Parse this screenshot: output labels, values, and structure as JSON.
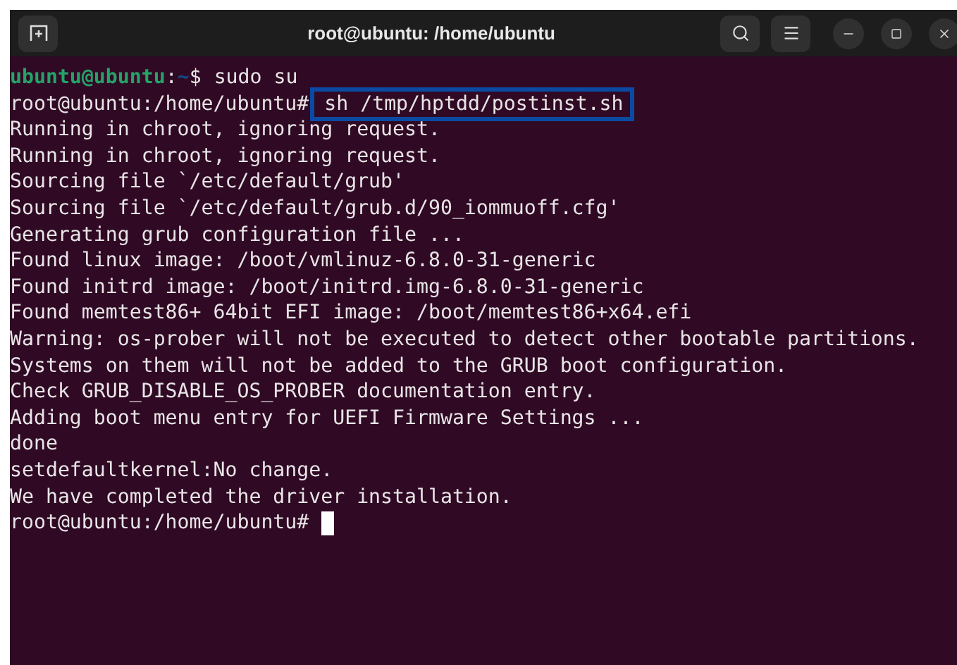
{
  "window": {
    "title": "root@ubuntu: /home/ubuntu"
  },
  "terminal": {
    "lines": [
      {
        "kind": "user_prompt",
        "user_host": "ubuntu@ubuntu",
        "separator": ":",
        "path": "~",
        "symbol": "$",
        "command": "sudo su"
      },
      {
        "kind": "root_prompt",
        "prompt": "root@ubuntu:/home/ubuntu#",
        "command": "sh /tmp/hptdd/postinst.sh",
        "highlighted": true,
        "cursor": false
      },
      {
        "kind": "output",
        "text": "Running in chroot, ignoring request."
      },
      {
        "kind": "output",
        "text": "Running in chroot, ignoring request."
      },
      {
        "kind": "output",
        "text": "Sourcing file `/etc/default/grub'"
      },
      {
        "kind": "output",
        "text": "Sourcing file `/etc/default/grub.d/90_iommuoff.cfg'"
      },
      {
        "kind": "output",
        "text": "Generating grub configuration file ..."
      },
      {
        "kind": "output",
        "text": "Found linux image: /boot/vmlinuz-6.8.0-31-generic"
      },
      {
        "kind": "output",
        "text": "Found initrd image: /boot/initrd.img-6.8.0-31-generic"
      },
      {
        "kind": "output",
        "text": "Found memtest86+ 64bit EFI image: /boot/memtest86+x64.efi"
      },
      {
        "kind": "output",
        "text": "Warning: os-prober will not be executed to detect other bootable partitions."
      },
      {
        "kind": "output",
        "text": "Systems on them will not be added to the GRUB boot configuration."
      },
      {
        "kind": "output",
        "text": "Check GRUB_DISABLE_OS_PROBER documentation entry."
      },
      {
        "kind": "output",
        "text": "Adding boot menu entry for UEFI Firmware Settings ..."
      },
      {
        "kind": "output",
        "text": "done"
      },
      {
        "kind": "output",
        "text": "setdefaultkernel:No change."
      },
      {
        "kind": "output",
        "text": "We have completed the driver installation."
      },
      {
        "kind": "root_prompt",
        "prompt": "root@ubuntu:/home/ubuntu#",
        "cursor": true
      }
    ]
  }
}
